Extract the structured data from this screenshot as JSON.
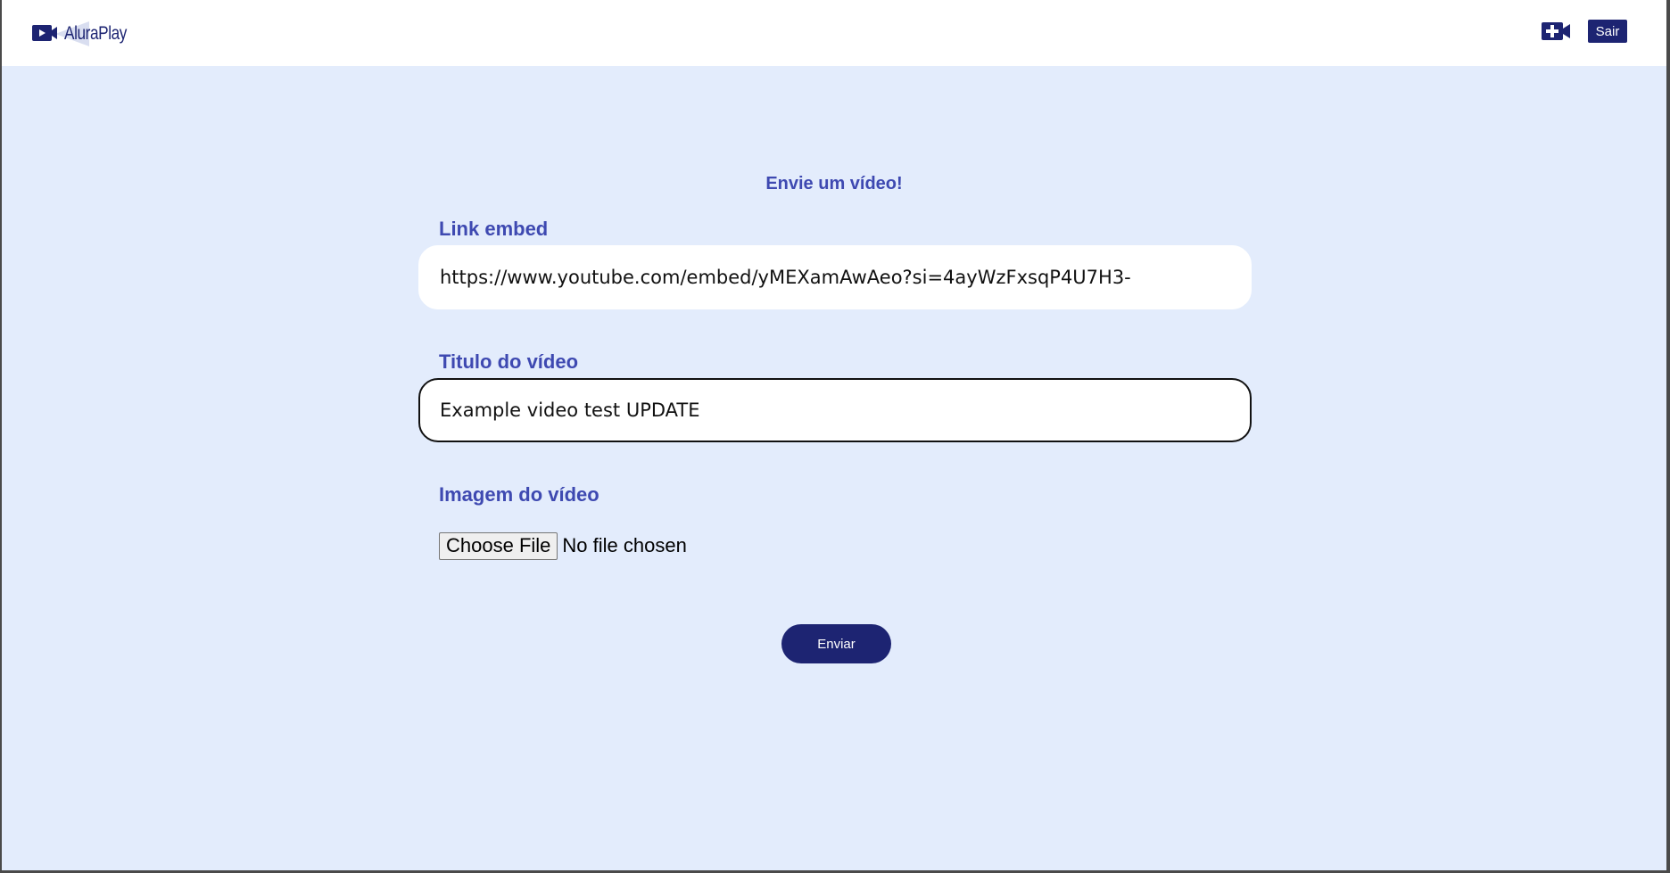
{
  "header": {
    "logo_text": "AluraPlay",
    "new_video_icon": "video-plus-icon",
    "logout_label": "Sair"
  },
  "form": {
    "title": "Envie um vídeo!",
    "embed_label": "Link embed",
    "embed_value": "https://www.youtube.com/embed/yMEXamAwAeo?si=4ayWzFxsqP4U7H3-",
    "video_title_label": "Titulo do vídeo",
    "video_title_value": "Example video test UPDATE",
    "image_label": "Imagem do vídeo",
    "file_button_label": "Choose File",
    "file_status": "No file chosen",
    "submit_label": "Enviar"
  },
  "colors": {
    "brand": "#1d2472",
    "label": "#3e49b1",
    "background": "#e3ecfc"
  }
}
